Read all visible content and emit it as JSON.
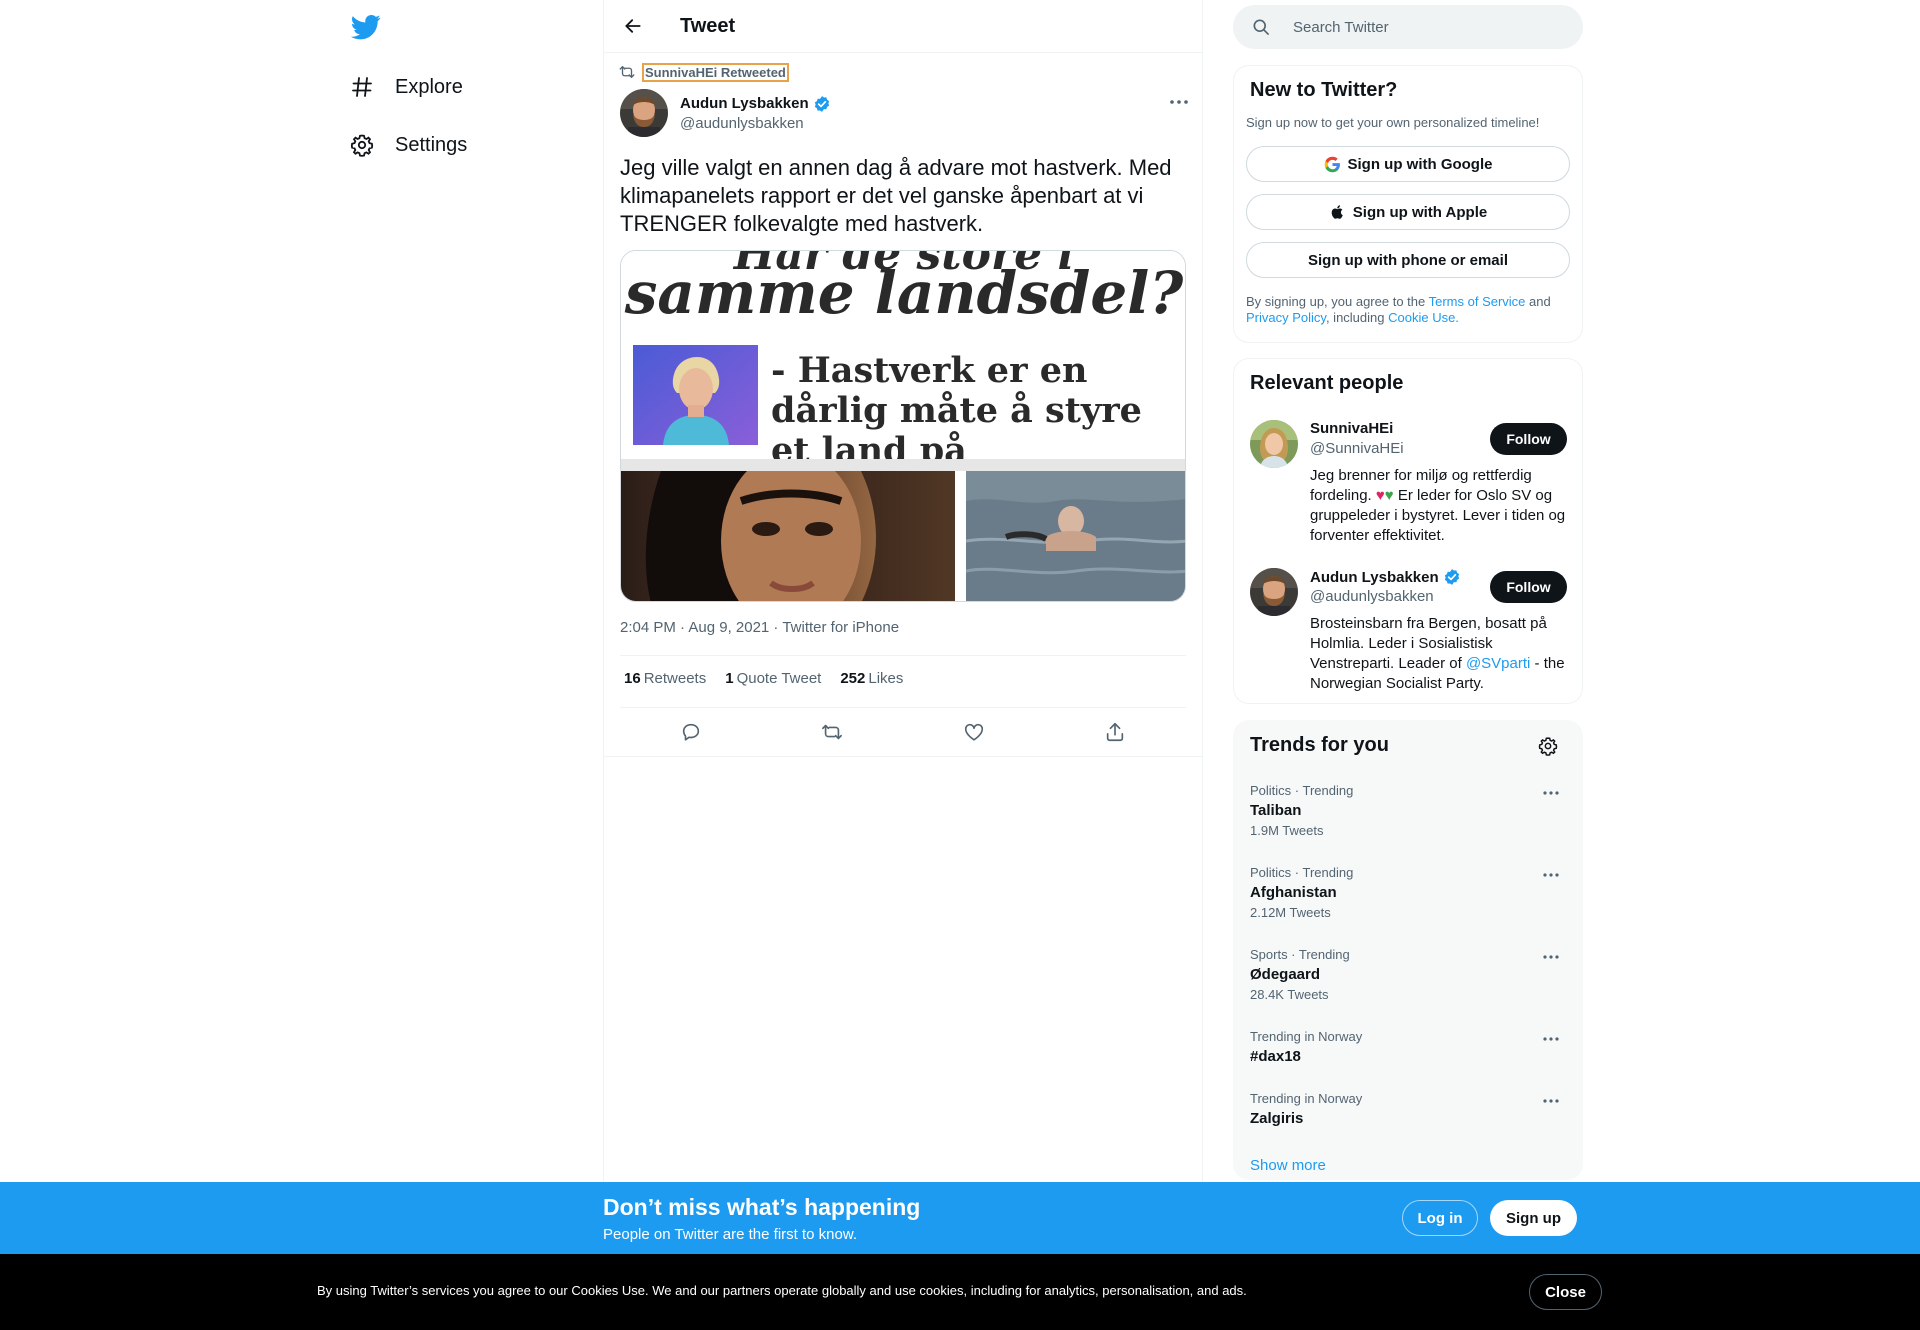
{
  "nav": {
    "explore_label": "Explore",
    "settings_label": "Settings"
  },
  "header": {
    "title": "Tweet"
  },
  "tweet": {
    "retweeted_by": "SunnivaHEi Retweeted",
    "author_name": "Audun Lysbakken",
    "author_handle": "@audunlysbakken",
    "text": "Jeg ville valgt en annen dag å advare mot hastverk. Med klimapanelets rapport er det vel ganske åpenbart at vi TRENGER folkevalgte med hastverk.",
    "media": {
      "headline_top": "Har de store i",
      "headline_main": "samme landsdel?",
      "headline_quote": "- Hastverk er en dårlig måte å styre et land på"
    },
    "meta": "2:04 PM · Aug 9, 2021 · Twitter for iPhone",
    "stats": {
      "retweets_count": "16",
      "retweets_label": "Retweets",
      "quotes_count": "1",
      "quotes_label": "Quote Tweet",
      "likes_count": "252",
      "likes_label": "Likes"
    }
  },
  "search": {
    "placeholder": "Search Twitter"
  },
  "new_to_twitter": {
    "title": "New to Twitter?",
    "subtitle": "Sign up now to get your own personalized timeline!",
    "google_label": "Sign up with Google",
    "apple_label": "Sign up with Apple",
    "phone_label": "Sign up with phone or email",
    "legal_prefix": "By signing up, you agree to the ",
    "terms_label": "Terms of Service",
    "legal_and": " and ",
    "privacy_label": "Privacy Policy",
    "legal_including": ", including ",
    "cookie_label": "Cookie Use."
  },
  "relevant_people": {
    "title": "Relevant people",
    "people": [
      {
        "name": "SunnivaHEi",
        "handle": "@SunnivaHEi",
        "follow_label": "Follow",
        "bio_part1": "Jeg brenner for miljø og rettferdig fordeling. ",
        "bio_hearts_red": "♥",
        "bio_hearts_green": "♥",
        "bio_part2": " Er leder for Oslo SV og gruppeleder i bystyret. Lever i tiden og forventer effektivitet."
      },
      {
        "name": "Audun Lysbakken",
        "handle": "@audunlysbakken",
        "follow_label": "Follow",
        "bio_part1": "Brosteinsbarn fra Bergen, bosatt på Holmlia. Leder i Sosialistisk Venstreparti. Leader of ",
        "bio_link": "@SVparti",
        "bio_part2": " - the Norwegian Socialist Party."
      }
    ]
  },
  "trends": {
    "title": "Trends for you",
    "items": [
      {
        "meta": "Politics · Trending",
        "name": "Taliban",
        "count": "1.9M Tweets"
      },
      {
        "meta": "Politics · Trending",
        "name": "Afghanistan",
        "count": "2.12M Tweets"
      },
      {
        "meta": "Sports · Trending",
        "name": "Ødegaard",
        "count": "28.4K Tweets"
      },
      {
        "meta": "Trending in Norway",
        "name": "#dax18",
        "count": ""
      },
      {
        "meta": "Trending in Norway",
        "name": "Zalgiris",
        "count": ""
      }
    ],
    "show_more": "Show more"
  },
  "banner": {
    "title": "Don’t miss what’s happening",
    "subtitle": "People on Twitter are the first to know.",
    "login_label": "Log in",
    "signup_label": "Sign up"
  },
  "cookie": {
    "text": "By using Twitter’s services you agree to our Cookies Use. We and our partners operate globally and use cookies, including for analytics, personalisation, and ads.",
    "close_label": "Close"
  },
  "colors": {
    "brand": "#1d9bf0",
    "text_primary": "#0f1419",
    "text_secondary": "#536471",
    "border": "#eff3f4"
  },
  "icons": [
    "twitter-logo-icon",
    "hashtag-icon",
    "gear-icon",
    "back-arrow-icon",
    "retweet-icon",
    "verified-icon",
    "more-icon",
    "reply-icon",
    "like-icon",
    "share-icon",
    "search-icon",
    "google-icon",
    "apple-icon"
  ]
}
